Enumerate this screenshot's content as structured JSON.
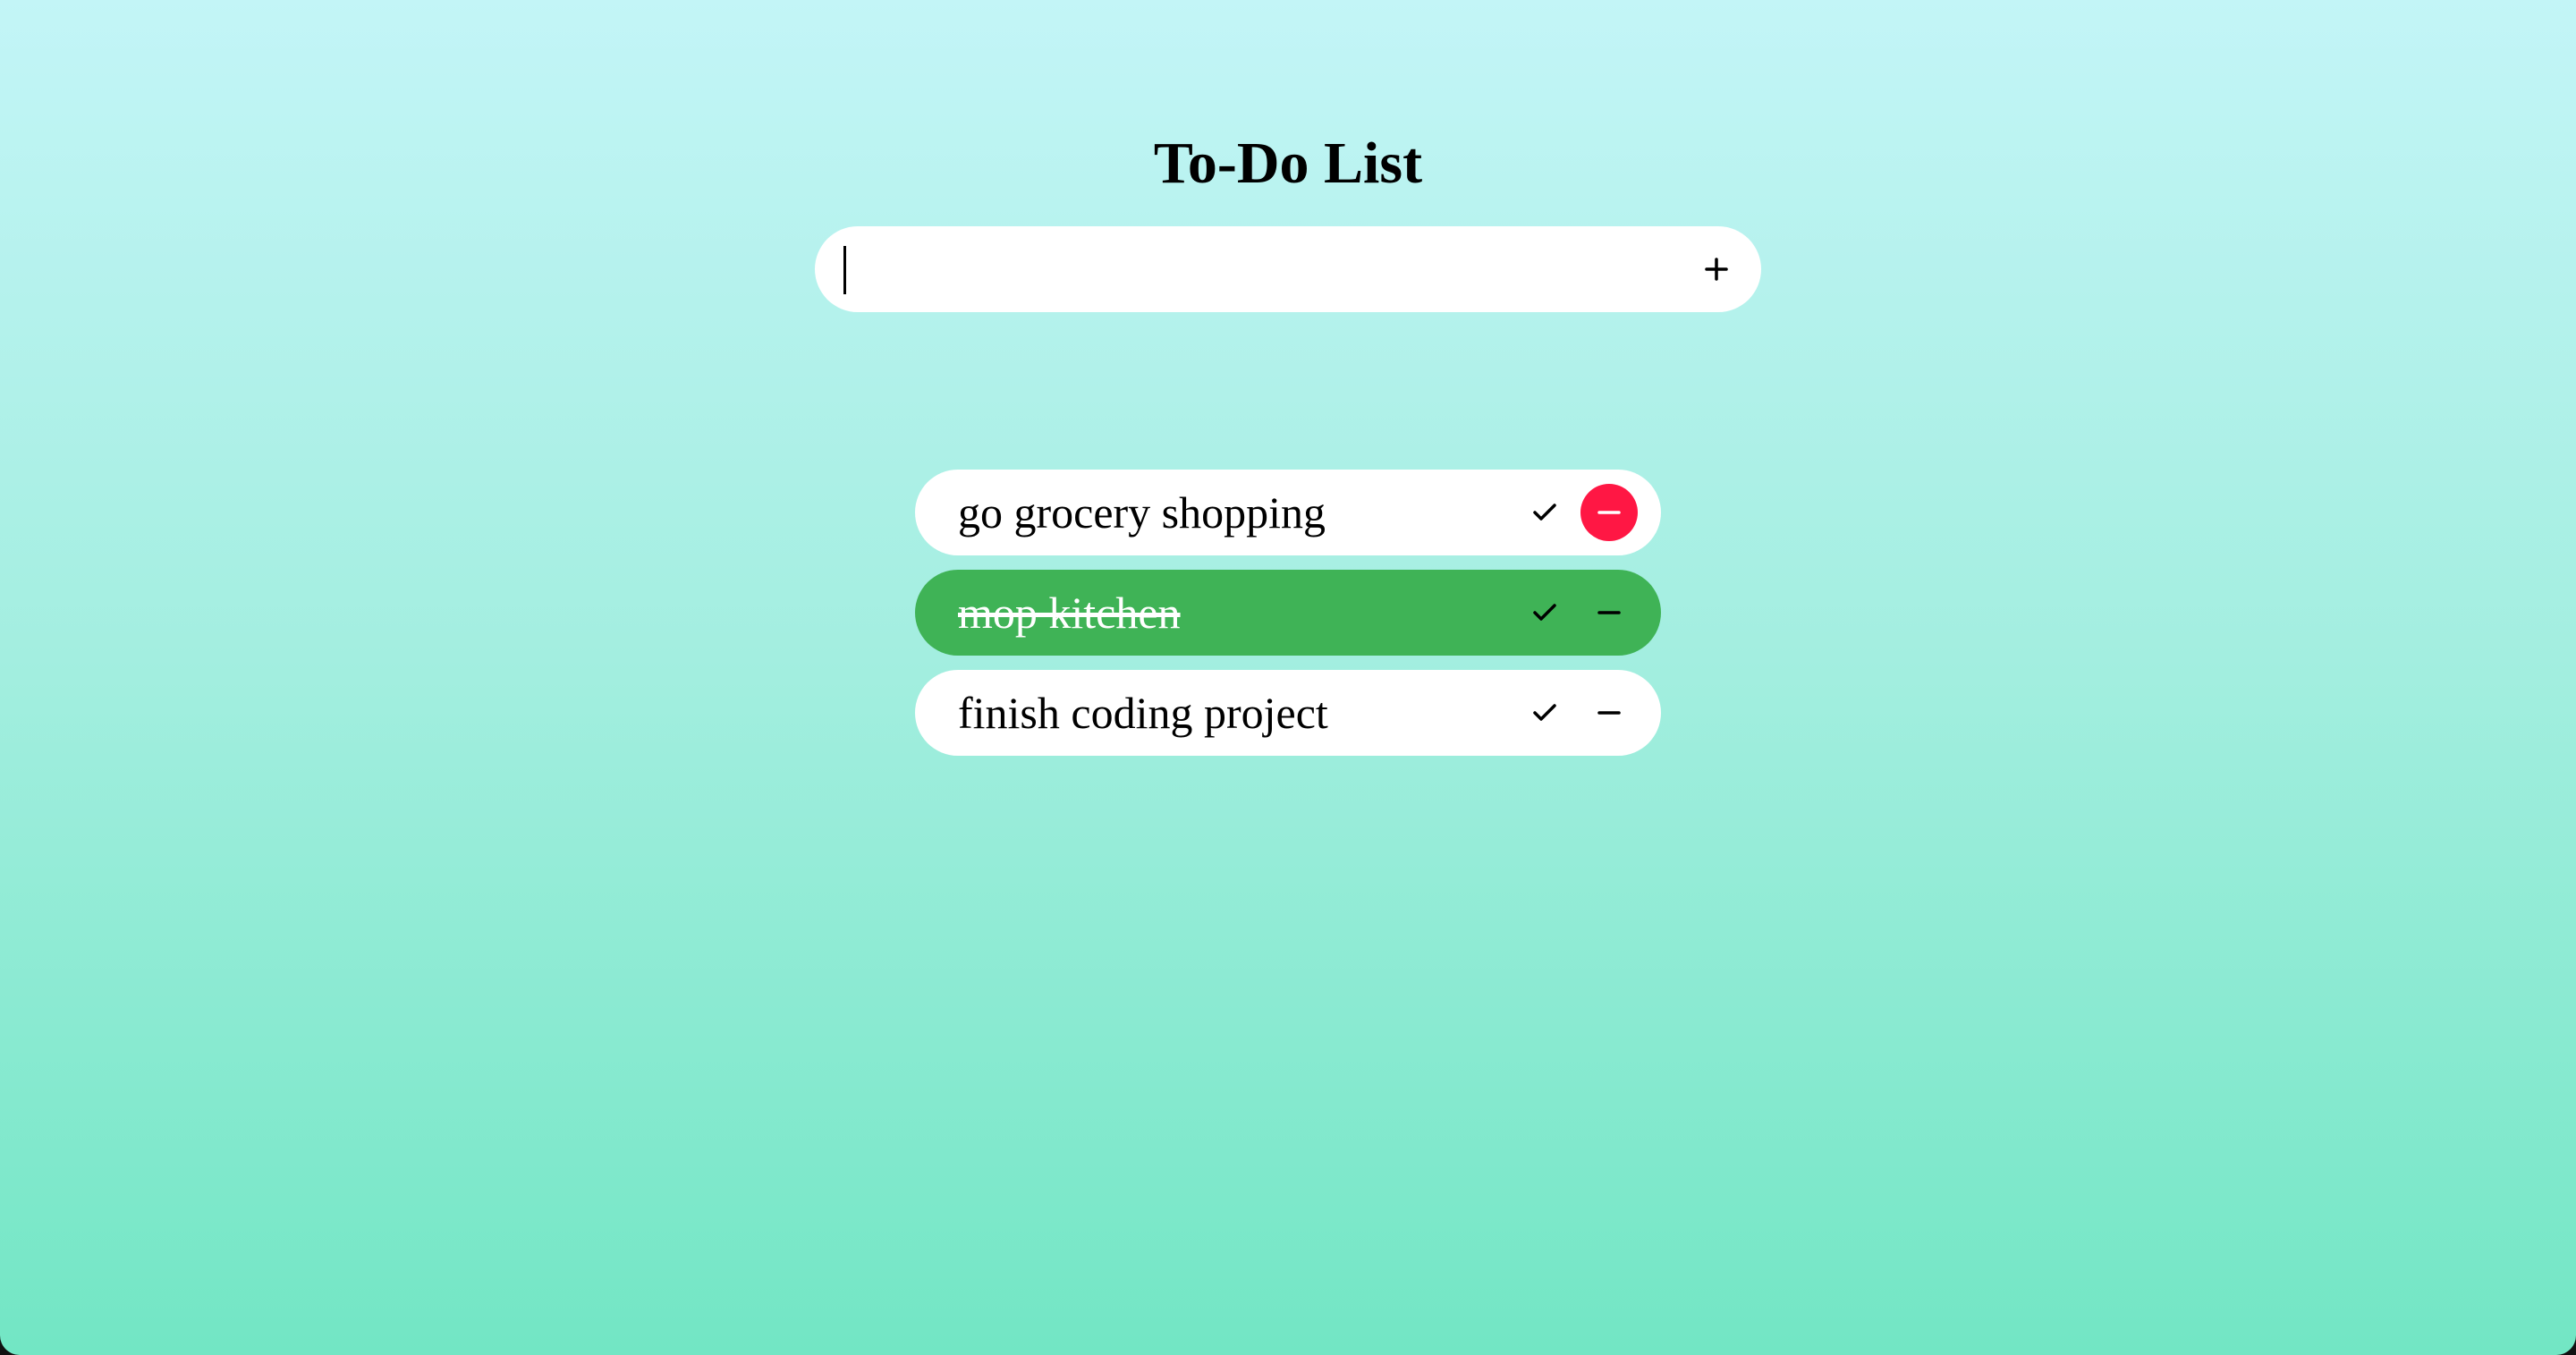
{
  "app": {
    "title": "To-Do List"
  },
  "new_task": {
    "value": "",
    "placeholder": "",
    "add_icon": "plus-icon"
  },
  "tasks": [
    {
      "text": "go grocery shopping",
      "completed": false,
      "remove_hovered": true
    },
    {
      "text": "mop kitchen",
      "completed": true,
      "remove_hovered": false
    },
    {
      "text": "finish coding project",
      "completed": false,
      "remove_hovered": false
    }
  ],
  "colors": {
    "completed_bg": "#3fb356",
    "remove_hover": "#ff1744",
    "gradient_top": "#c3f5f7",
    "gradient_bottom": "#72e6c4"
  }
}
